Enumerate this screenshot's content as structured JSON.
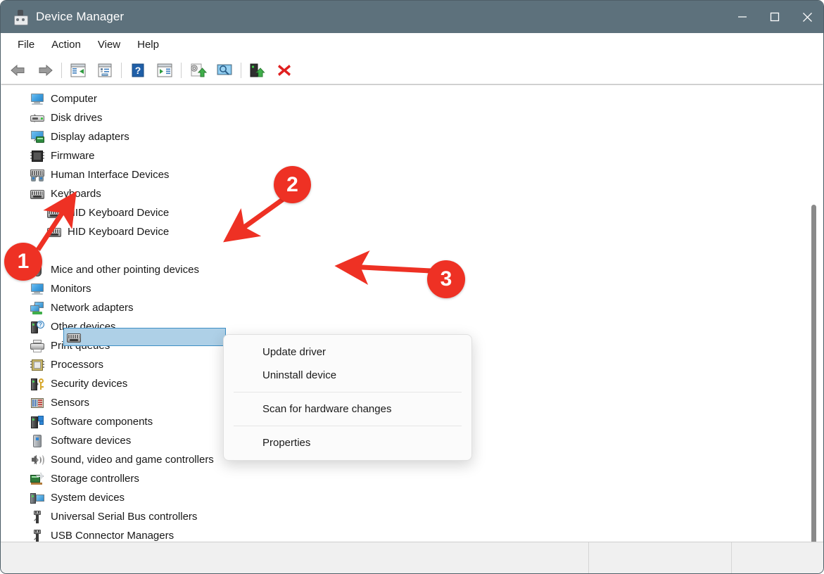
{
  "window": {
    "title": "Device Manager",
    "app_icon": "device-manager-icon",
    "controls": [
      {
        "name": "minimize",
        "glyph": "minimize-icon"
      },
      {
        "name": "maximize",
        "glyph": "maximize-icon"
      },
      {
        "name": "close",
        "glyph": "close-icon"
      }
    ],
    "titlebar_color": "#5d717c"
  },
  "menubar": {
    "items": [
      {
        "label": "File"
      },
      {
        "label": "Action"
      },
      {
        "label": "View"
      },
      {
        "label": "Help"
      }
    ]
  },
  "toolbar": {
    "buttons": [
      {
        "name": "back-button",
        "icon": "back-arrow-icon"
      },
      {
        "name": "forward-button",
        "icon": "forward-arrow-icon"
      },
      {
        "name": "show-hide-console-tree-button",
        "icon": "console-tree-icon"
      },
      {
        "name": "properties-button",
        "icon": "properties-window-icon"
      },
      {
        "name": "help-button",
        "icon": "question-mark-icon"
      },
      {
        "name": "show-hide-action-pane-button",
        "icon": "action-pane-icon"
      },
      {
        "name": "update-driver-button",
        "icon": "update-driver-icon"
      },
      {
        "name": "scan-hardware-changes-button",
        "icon": "scan-monitor-icon"
      },
      {
        "name": "uninstall-device-button",
        "icon": "uninstall-device-icon"
      },
      {
        "name": "disable-device-button",
        "icon": "red-x-icon"
      }
    ]
  },
  "tree": {
    "rows": [
      {
        "label": "Computer",
        "level": 0,
        "expanded": false,
        "icon": "monitor-icon"
      },
      {
        "label": "Disk drives",
        "level": 0,
        "expanded": false,
        "icon": "disk-drive-icon"
      },
      {
        "label": "Display adapters",
        "level": 0,
        "expanded": false,
        "icon": "display-adapter-icon"
      },
      {
        "label": "Firmware",
        "level": 0,
        "expanded": false,
        "icon": "firmware-chip-icon"
      },
      {
        "label": "Human Interface Devices",
        "level": 0,
        "expanded": false,
        "icon": "hid-icon"
      },
      {
        "label": "Keyboards",
        "level": 0,
        "expanded": true,
        "icon": "keyboard-icon"
      },
      {
        "label": "HID Keyboard Device",
        "level": 1,
        "expanded": null,
        "icon": "keyboard-icon"
      },
      {
        "label": "HID Keyboard Device",
        "level": 1,
        "expanded": null,
        "icon": "keyboard-icon"
      },
      {
        "label": "",
        "level": 1,
        "expanded": null,
        "icon": "keyboard-icon",
        "selected": true
      },
      {
        "label": "Mice and other pointing devices",
        "level": 0,
        "expanded": false,
        "icon": "mouse-icon"
      },
      {
        "label": "Monitors",
        "level": 0,
        "expanded": false,
        "icon": "monitor-icon"
      },
      {
        "label": "Network adapters",
        "level": 0,
        "expanded": false,
        "icon": "network-adapter-icon"
      },
      {
        "label": "Other devices",
        "level": 0,
        "expanded": false,
        "icon": "other-devices-icon"
      },
      {
        "label": "Print queues",
        "level": 0,
        "expanded": false,
        "icon": "printer-icon"
      },
      {
        "label": "Processors",
        "level": 0,
        "expanded": false,
        "icon": "processor-icon"
      },
      {
        "label": "Security devices",
        "level": 0,
        "expanded": false,
        "icon": "security-device-icon"
      },
      {
        "label": "Sensors",
        "level": 0,
        "expanded": false,
        "icon": "sensor-icon"
      },
      {
        "label": "Software components",
        "level": 0,
        "expanded": false,
        "icon": "software-component-icon"
      },
      {
        "label": "Software devices",
        "level": 0,
        "expanded": false,
        "icon": "software-device-icon"
      },
      {
        "label": "Sound, video and game controllers",
        "level": 0,
        "expanded": false,
        "icon": "sound-icon"
      },
      {
        "label": "Storage controllers",
        "level": 0,
        "expanded": false,
        "icon": "storage-controller-icon"
      },
      {
        "label": "System devices",
        "level": 0,
        "expanded": false,
        "icon": "system-device-icon"
      },
      {
        "label": "Universal Serial Bus controllers",
        "level": 0,
        "expanded": false,
        "icon": "usb-icon"
      },
      {
        "label": "USB Connector Managers",
        "level": 0,
        "expanded": false,
        "icon": "usb-icon"
      }
    ]
  },
  "context_menu": {
    "items": [
      {
        "label": "Update driver",
        "separator_after": false
      },
      {
        "label": "Uninstall device",
        "separator_after": true
      },
      {
        "label": "Scan for hardware changes",
        "separator_after": true
      },
      {
        "label": "Properties",
        "separator_after": false
      }
    ]
  },
  "annotations": {
    "accent_color": "#ee3124",
    "markers": [
      {
        "id": "1",
        "label": "1",
        "points_to": "Keyboards"
      },
      {
        "id": "2",
        "label": "2",
        "points_to": "selected keyboard device row"
      },
      {
        "id": "3",
        "label": "3",
        "points_to": "Update driver"
      }
    ]
  }
}
